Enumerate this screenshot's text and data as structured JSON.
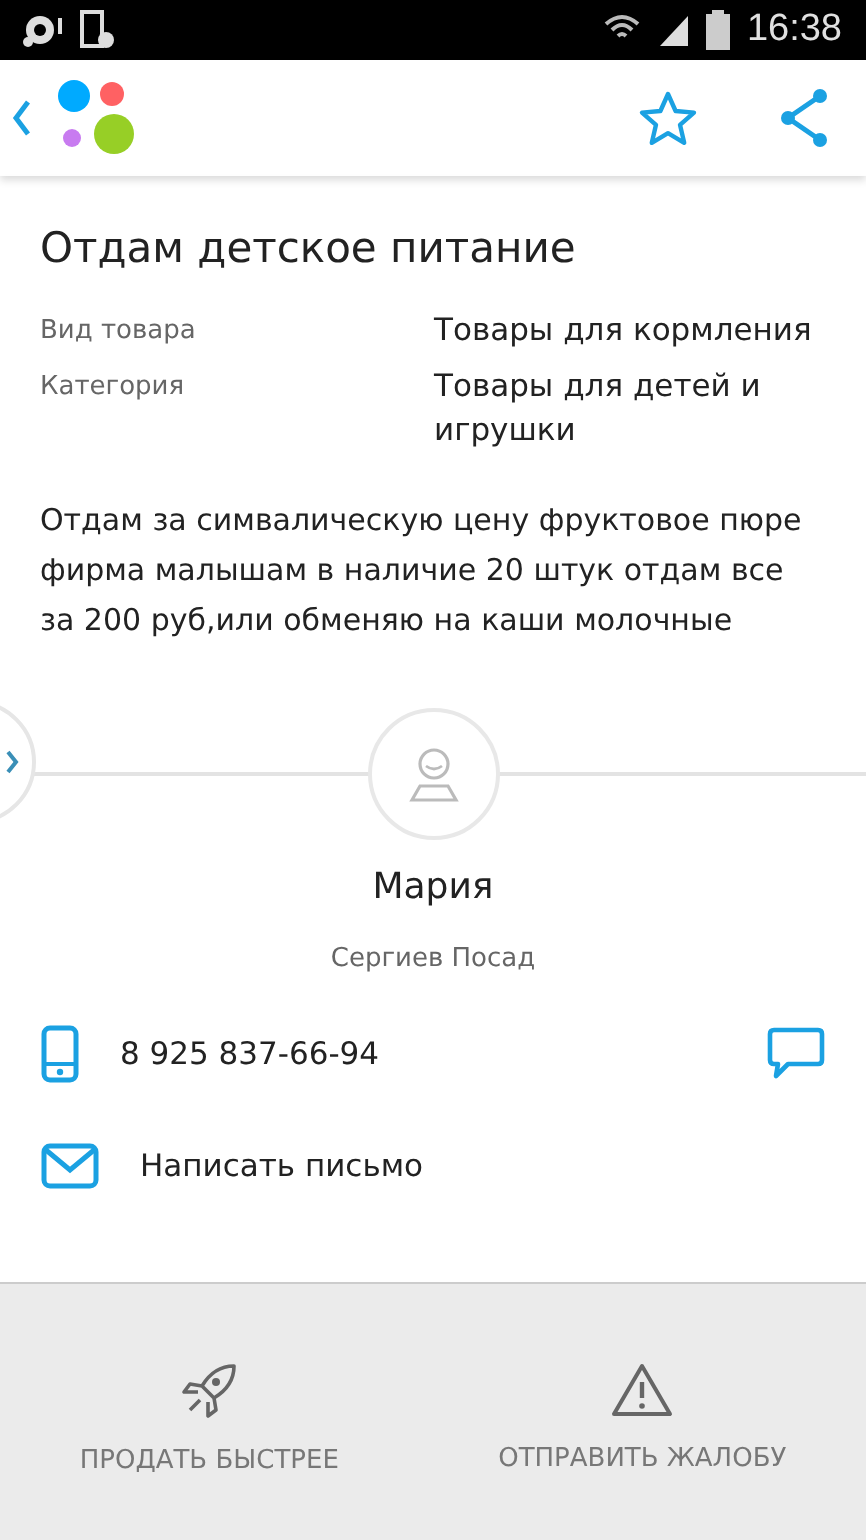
{
  "status_bar": {
    "time": "16:38"
  },
  "ad": {
    "title": "Отдам детское питание",
    "attributes": [
      {
        "label": "Вид товара",
        "value": "Товары для кормления"
      },
      {
        "label": "Категория",
        "value": "Товары для детей и игрушки"
      }
    ],
    "description": "Отдам за симвалическую цену фруктовое пюре фирма малышам в наличие 20 штук отдам все за 200 руб,или обменяю на каши молочные"
  },
  "seller": {
    "name": "Мария",
    "city": "Сергиев Посад",
    "phone": "8 925 837-66-94",
    "write_label": "Написать письмо"
  },
  "actions": [
    {
      "kind": "boost",
      "label": "ПРОДАТЬ БЫСТРЕЕ"
    },
    {
      "kind": "report",
      "label": "ОТПРАВИТЬ ЖАЛОБУ"
    }
  ]
}
